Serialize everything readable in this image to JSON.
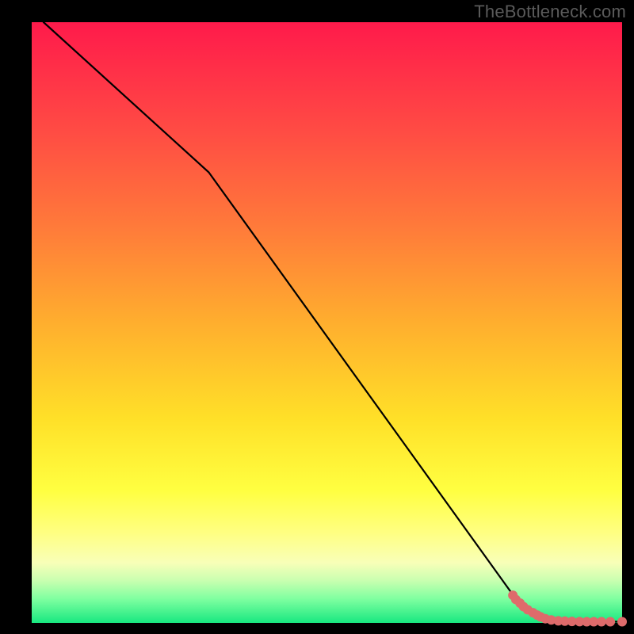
{
  "attribution": "TheBottleneck.com",
  "chart_data": {
    "type": "line",
    "title": "",
    "xlabel": "",
    "ylabel": "",
    "xlim": [
      0,
      100
    ],
    "ylim": [
      0,
      100
    ],
    "grid": false,
    "series": [
      {
        "name": "curve",
        "x": [
          2,
          30,
          82,
          85,
          90,
          95,
          100
        ],
        "values": [
          100,
          75,
          4,
          1.5,
          0.5,
          0.2,
          0.2
        ]
      }
    ],
    "points": {
      "name": "markers",
      "color": "#de6b6b",
      "x": [
        81.5,
        82,
        82.7,
        83.3,
        84,
        84.9,
        85.6,
        86.2,
        87,
        88,
        89.2,
        90.3,
        91.5,
        92.8,
        94,
        95.2,
        96.5,
        98,
        100
      ],
      "values": [
        4.6,
        3.9,
        3.3,
        2.7,
        2.2,
        1.7,
        1.3,
        1.0,
        0.7,
        0.5,
        0.35,
        0.3,
        0.25,
        0.22,
        0.2,
        0.2,
        0.2,
        0.2,
        0.2
      ]
    },
    "background_gradient": {
      "top": "#ff1a4b",
      "mid_upper": "#ff7a3a",
      "mid": "#ffe028",
      "mid_lower": "#ffff82",
      "bottom": "#18e880"
    }
  }
}
